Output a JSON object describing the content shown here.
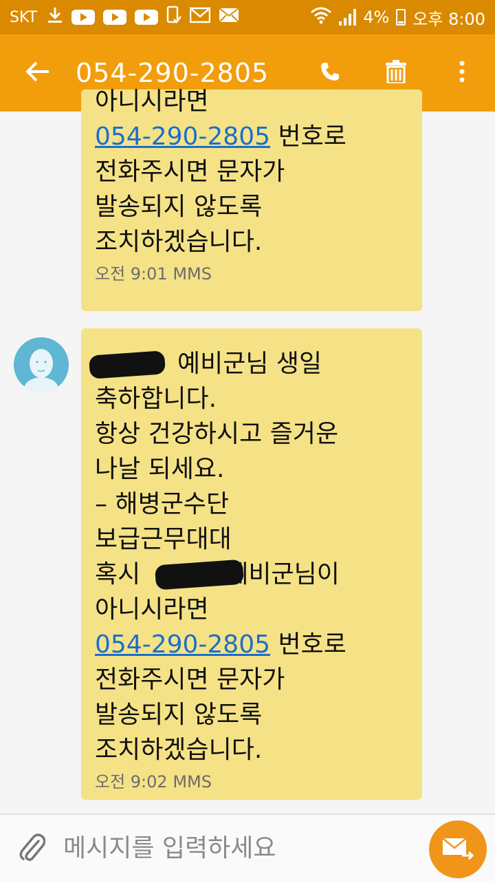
{
  "status_bar": {
    "carrier": "SKT",
    "battery": "4%",
    "time": "오후 8:00",
    "icons": [
      "download-icon",
      "youtube-icon",
      "youtube-icon",
      "youtube-icon",
      "phone-check-icon",
      "gmail-icon",
      "mail-icon",
      "wifi-icon",
      "signal-icon",
      "battery-charging-icon"
    ]
  },
  "header": {
    "title": "054-290-2805",
    "icons": [
      "back-arrow-icon",
      "phone-icon",
      "trash-icon",
      "more-vert-icon"
    ]
  },
  "messages": [
    {
      "line_top": "아니시라면",
      "phone_link": "054-290-2805",
      "after_link": " 번호로",
      "rest": "전화주시면 문자가\n발송되지 않도록\n조치하겠습니다.",
      "time": "오전 9:01",
      "type": "MMS"
    },
    {
      "line1_after_redact": "예비군님 생일",
      "body": "축하합니다.\n항상 건강하시고 즐거운\n나날 되세요.\n – 해병군수단\n보급근무대대",
      "line_hoksi": " 혹시",
      "line_hoksi_after": "예비군님이",
      "line_top": "아니시라면",
      "phone_link": "054-290-2805",
      "after_link": " 번호로",
      "rest": "전화주시면 문자가\n발송되지 않도록\n조치하겠습니다.",
      "time": "오전 9:02",
      "type": "MMS"
    }
  ],
  "composer": {
    "placeholder": "메시지를 입력하세요"
  },
  "colors": {
    "status_bar": "#d98a00",
    "app_bar": "#f29d0b",
    "bubble": "#f5e287",
    "link": "#1a6fcc",
    "send_button": "#f0951a"
  }
}
